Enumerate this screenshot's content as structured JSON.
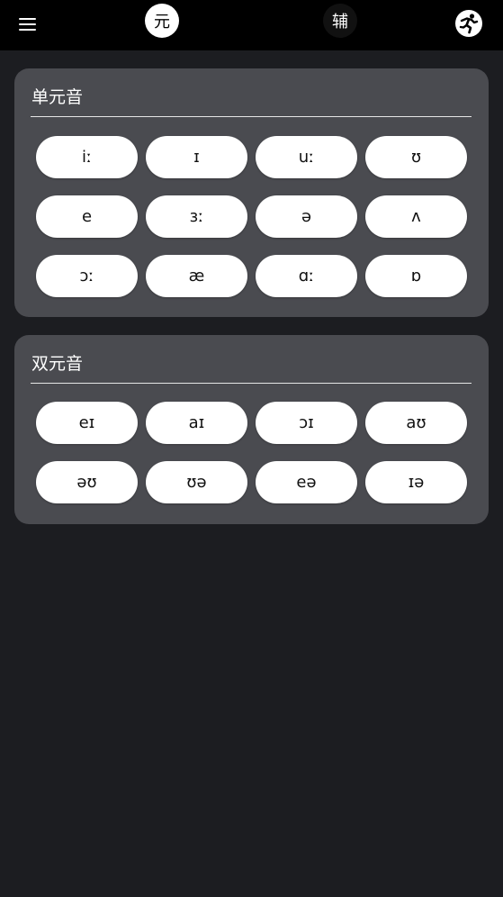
{
  "header": {
    "menu_icon": "hamburger-menu-icon",
    "tabs": [
      {
        "label": "元",
        "active": true
      },
      {
        "label": "辅",
        "active": false
      }
    ],
    "action_icon": "running-person-icon"
  },
  "sections": [
    {
      "title": "单元音",
      "symbols": [
        "iː",
        "ɪ",
        "uː",
        "ʊ",
        "e",
        "ɜː",
        "ə",
        "ʌ",
        "ɔː",
        "æ",
        "ɑː",
        "ɒ"
      ]
    },
    {
      "title": "双元音",
      "symbols": [
        "eɪ",
        "aɪ",
        "ɔɪ",
        "aʊ",
        "əʊ",
        "ʊə",
        "eə",
        "ɪə"
      ]
    }
  ],
  "colors": {
    "background": "#1c1d21",
    "topbar": "#000000",
    "card": "#4a4b50",
    "pill": "#ffffff"
  }
}
